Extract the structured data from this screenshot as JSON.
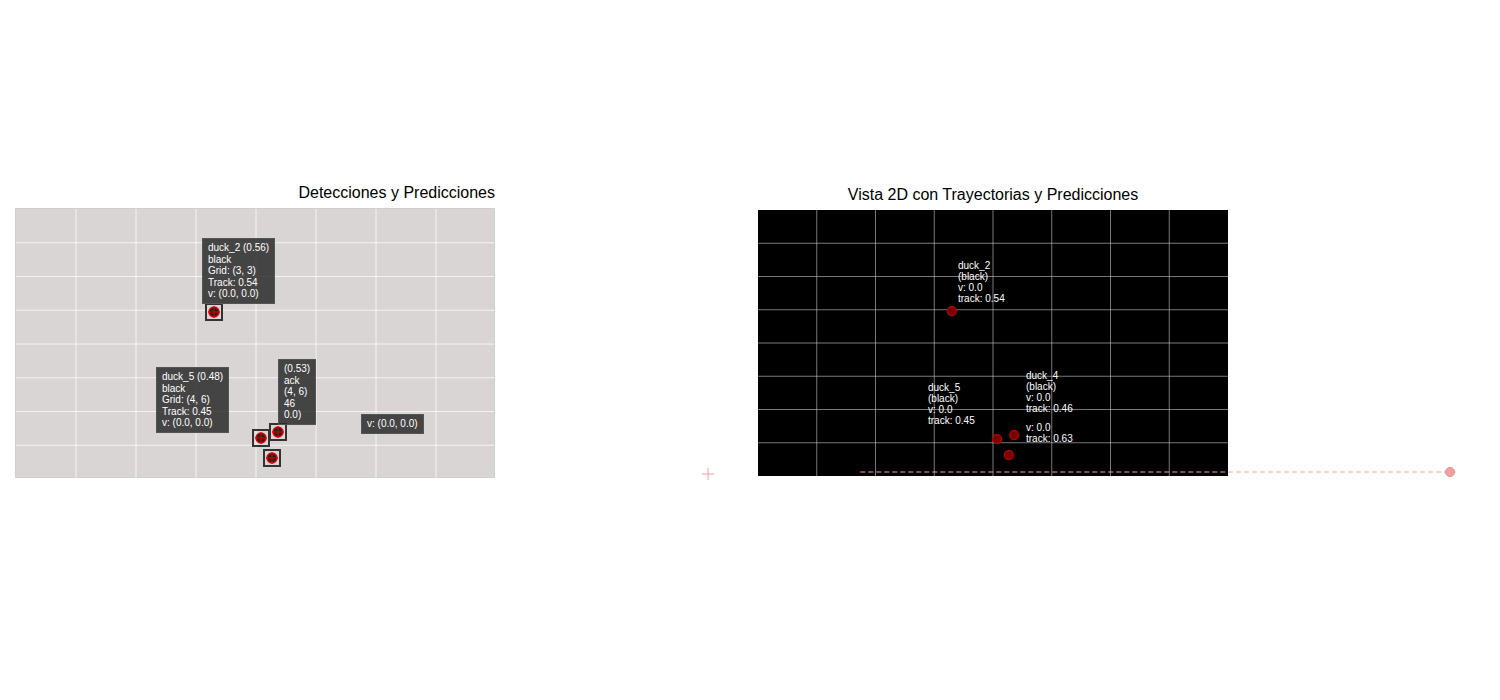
{
  "left": {
    "title": "Detecciones y Predicciones",
    "detections": [
      {
        "x": 3.3,
        "y": 3.05,
        "lines": [
          "duck_2 (0.56)",
          "black",
          "Grid: (3, 3)",
          "Track: 0.54",
          "v: (0.0, 0.0)"
        ]
      },
      {
        "x": 4.08,
        "y": 6.79,
        "lines": [
          "duck_5 (0.48)",
          "black",
          "Grid: (4, 6)",
          "Track: 0.45",
          "v: (0.0, 0.0)"
        ]
      },
      {
        "x": 4.36,
        "y": 6.6,
        "lines": [
          "(0.53)",
          "ack",
          "(4, 6)",
          "46",
          "0.0)"
        ]
      },
      {
        "x": 4.27,
        "y": 7.38,
        "lines": [
          "v: (0.0, 0.0)"
        ]
      }
    ]
  },
  "right": {
    "title": "Vista 2D con Trayectorias y Predicciones",
    "points": [
      {
        "x": 3.3,
        "y": 3.04,
        "lines": [
          "duck_2",
          "(black)",
          "v: 0.0",
          "track: 0.54"
        ]
      },
      {
        "x": 4.07,
        "y": 6.89,
        "lines": [
          "duck_5",
          "(black)",
          "v: 0.0",
          "track: 0.45"
        ]
      },
      {
        "x": 4.36,
        "y": 6.77,
        "lines": [
          "duck_4",
          "(black)",
          "v: 0.0",
          "track: 0.46"
        ]
      },
      {
        "x": 4.27,
        "y": 7.37,
        "lines": [
          "v: 0.0",
          "track: 0.63"
        ]
      }
    ],
    "prediction": {
      "from_x": 1.74,
      "to_x": 11.78,
      "y": 7.88,
      "cross_x": -0.85,
      "cross_y": 7.94
    }
  }
}
